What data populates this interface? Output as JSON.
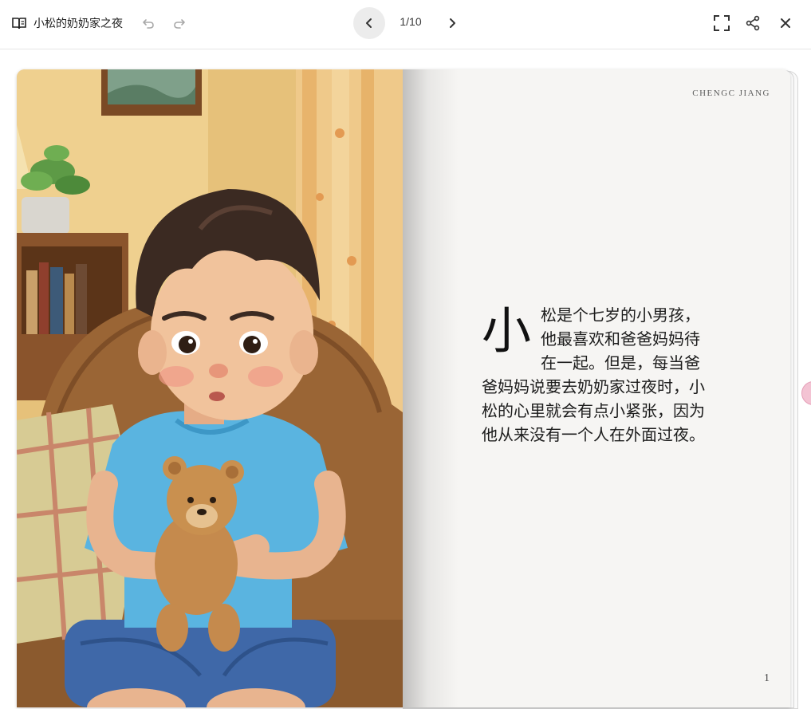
{
  "header": {
    "title": "小松的奶奶家之夜",
    "page_indicator": "1/10"
  },
  "icons": {
    "book": "book-open-icon",
    "undo": "undo-icon",
    "redo": "redo-icon",
    "prev": "chevron-left-icon",
    "next": "chevron-right-icon",
    "fullscreen": "fullscreen-icon",
    "share": "share-icon",
    "close": "close-icon"
  },
  "page": {
    "author": "CHENGC JIANG",
    "drop_cap": "小",
    "body_text": "松是个七岁的小男孩，他最喜欢和爸爸妈妈待在一起。但是，每当爸爸妈妈说要去奶奶家过夜时，小松的心里就会有点小紧张，因为他从来没有一个人在外面过夜。",
    "number": "1"
  },
  "colors": {
    "accent_bg": "#ececec",
    "page_bg": "#f6f5f3",
    "shirt": "#5ab4e0",
    "shorts": "#3f68a8",
    "sofa": "#9a6535",
    "wall": "#e9c77a"
  }
}
